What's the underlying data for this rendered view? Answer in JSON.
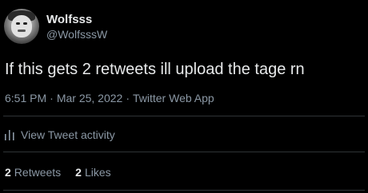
{
  "author": {
    "display_name": "Wolfsss",
    "handle": "@WolfsssW"
  },
  "tweet": {
    "text": "If this gets 2 retweets ill upload the tage rn",
    "time": "6:51 PM",
    "separator": "·",
    "date": "Mar 25, 2022",
    "client": "Twitter Web App"
  },
  "activity": {
    "label": "View Tweet activity",
    "icon": "activity-bars-icon"
  },
  "stats": {
    "retweets_count": "2",
    "retweets_label": "Retweets",
    "likes_count": "2",
    "likes_label": "Likes"
  },
  "colors": {
    "background": "#000000",
    "primary_text": "#e7e9ea",
    "secondary_text": "#8b98a5",
    "divider": "#2f3336"
  }
}
